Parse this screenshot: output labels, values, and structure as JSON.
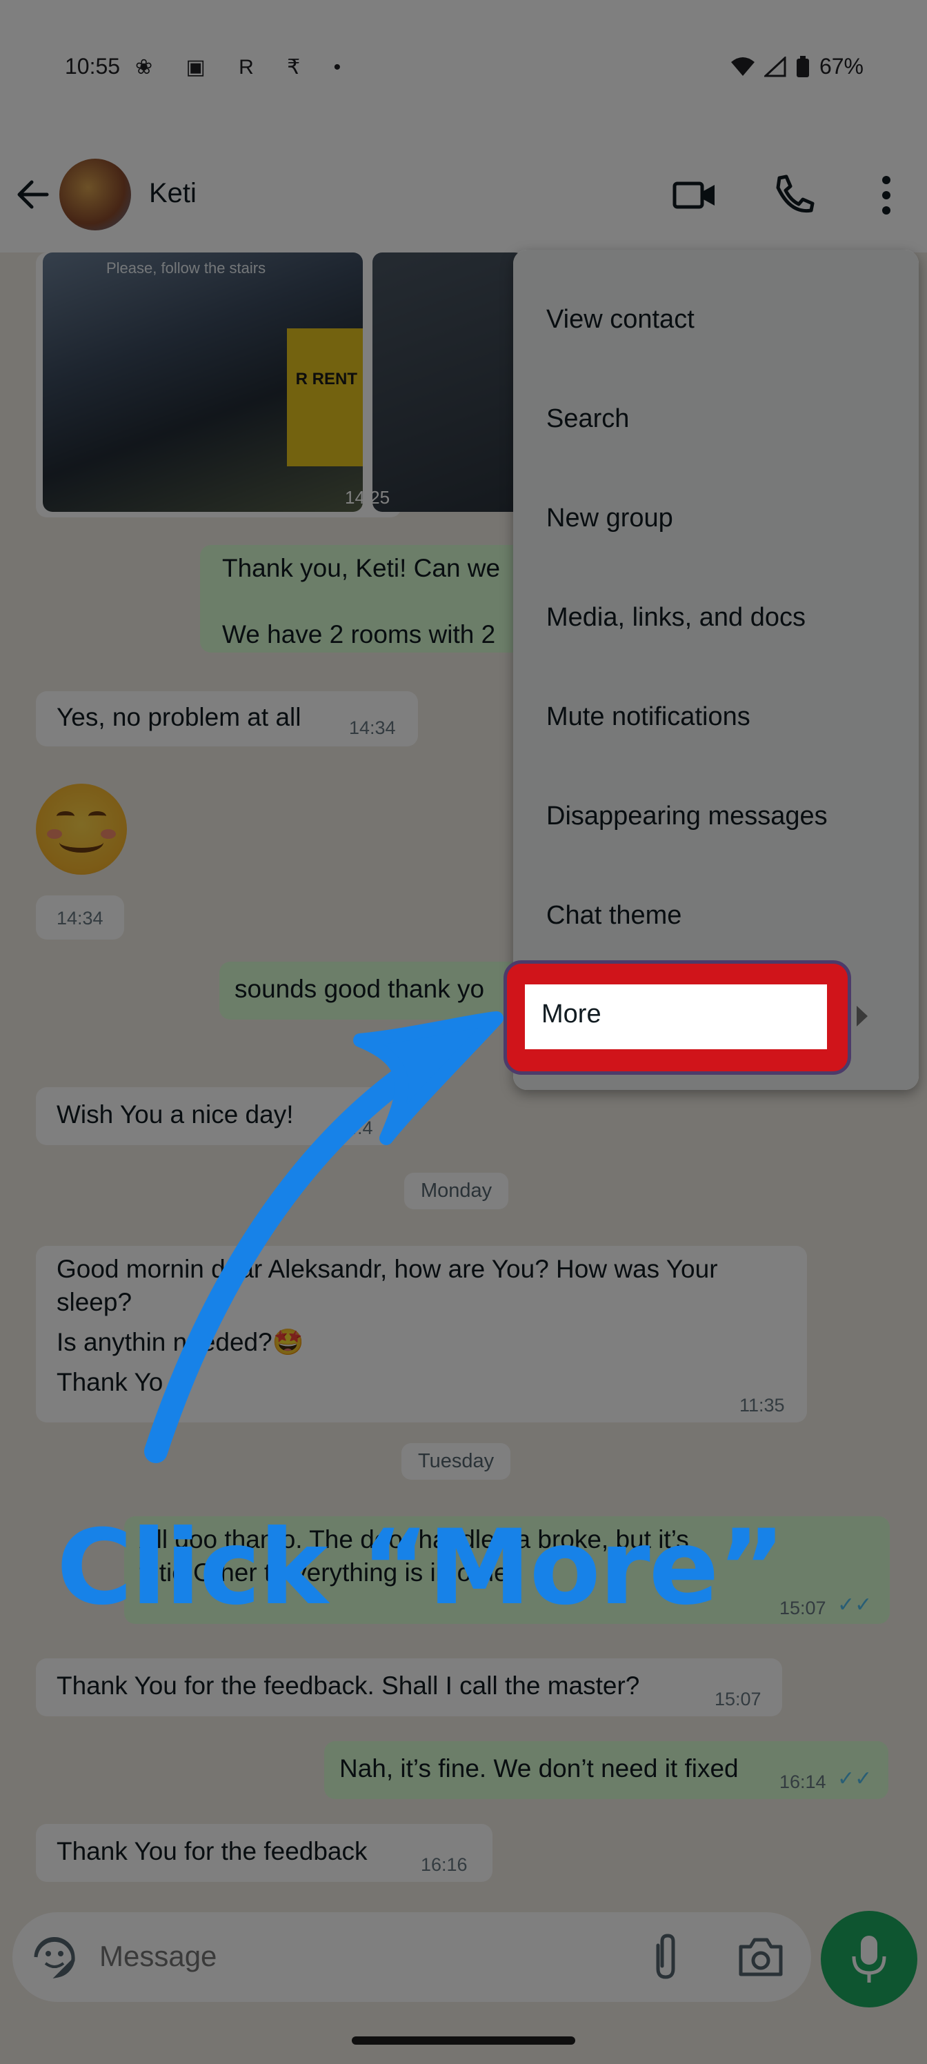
{
  "status_bar": {
    "time": "10:55",
    "left_icons": "❀ ▣ R ₹ •",
    "battery": "67%"
  },
  "header": {
    "contact_name": "Keti"
  },
  "photos": {
    "caption": "Please, follow the stairs",
    "sign_text": "R RENT",
    "time": "14:25"
  },
  "messages": [
    {
      "id": "m1",
      "dir": "out",
      "lines": [
        "Thank you, Keti! Can we",
        "",
        "We have 2 rooms with 2"
      ],
      "time": ""
    },
    {
      "id": "m2",
      "dir": "in",
      "text": "Yes, no problem at all",
      "time": "14:34"
    },
    {
      "id": "m3",
      "dir": "in",
      "emoji": "smiling-face",
      "time": "14:34"
    },
    {
      "id": "m4",
      "dir": "out",
      "text": "sounds good thank yo",
      "time": ""
    },
    {
      "id": "m5",
      "dir": "in",
      "text": "Wish You a nice day!",
      "time": "14:4"
    },
    {
      "id": "m6",
      "dir": "in",
      "lines": [
        "Good mornin  dear Aleksandr, how are You? How was Your",
        "sleep?",
        "Is anythin  needed?🤩",
        "Thank Yo"
      ],
      "time": "11:35"
    },
    {
      "id": "m7",
      "dir": "out",
      "lines": [
        "All goo  than    o. The door handle    da broke, but it’s",
        "fi   tio   Other           t   r  verything is in order."
      ],
      "time": "15:07"
    },
    {
      "id": "m8",
      "dir": "in",
      "text": "Thank You for the feedback. Shall I call the master?",
      "time": "15:07"
    },
    {
      "id": "m9",
      "dir": "out",
      "text": "Nah, it’s fine. We don’t need it fixed",
      "time": "16:14"
    },
    {
      "id": "m10",
      "dir": "in",
      "text": "Thank You for the feedback",
      "time": "16:16"
    }
  ],
  "day_chips": {
    "monday": "Monday",
    "tuesday": "Tuesday"
  },
  "input": {
    "placeholder": "Message"
  },
  "menu": {
    "items": [
      "View contact",
      "Search",
      "New group",
      "Media, links, and docs",
      "Mute notifications",
      "Disappearing messages",
      "Chat theme",
      "More"
    ]
  },
  "annotation": {
    "text": "Click “More”",
    "color": "#1782e8",
    "highlight_color": "#d0141a"
  }
}
